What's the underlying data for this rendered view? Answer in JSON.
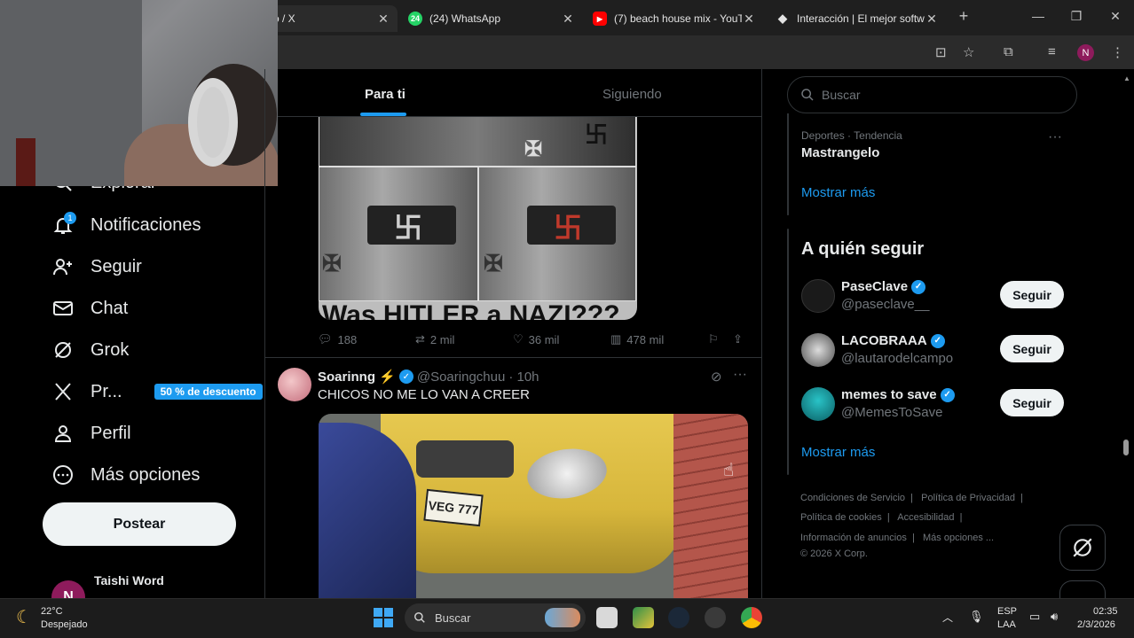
{
  "browser": {
    "tabs": [
      {
        "title": "o / X",
        "favicon": "x-logo-icon"
      },
      {
        "title": "(24) WhatsApp",
        "favicon": "whatsapp-icon",
        "badge": "24"
      },
      {
        "title": "(7) beach house mix - YouTu",
        "favicon": "youtube-icon"
      },
      {
        "title": "Interacción | El mejor softwa",
        "favicon": "diamond-icon"
      }
    ],
    "profile_initial": "N"
  },
  "nav": {
    "items": [
      {
        "label": "Explorar",
        "icon": "search-icon"
      },
      {
        "label": "Notificaciones",
        "icon": "bell-icon",
        "badge": "1"
      },
      {
        "label": "Seguir",
        "icon": "add-user-icon"
      },
      {
        "label": "Chat",
        "icon": "mail-icon"
      },
      {
        "label": "Grok",
        "icon": "grok-icon"
      },
      {
        "label": "Pr...",
        "icon": "x-logo-icon",
        "promo": "50 % de descuento"
      },
      {
        "label": "Perfil",
        "icon": "user-icon"
      },
      {
        "label": "Más opciones",
        "icon": "more-circle-icon"
      }
    ],
    "post_button": "Postear",
    "account_name": "Taishi Word",
    "account_initial": "N"
  },
  "feed": {
    "tabs": [
      "Para ti",
      "Siguiendo"
    ],
    "tweet1": {
      "image_caption": "Was HITLER a NAZI???",
      "replies": "188",
      "reposts": "2 mil",
      "likes": "36 mil",
      "views": "478 mil"
    },
    "tweet2": {
      "name": "Soarinng ⚡",
      "handle": "@Soaringchuu",
      "time": "· 10h",
      "text": "CHICOS NO ME LO VAN A CREER",
      "plate": "VEG 777"
    }
  },
  "sidebar": {
    "search_placeholder": "Buscar",
    "trend": {
      "meta": "Deportes · Tendencia",
      "name": "Mastrangelo"
    },
    "show_more": "Mostrar más",
    "who_to_follow_title": "A quién seguir",
    "follow_button": "Seguir",
    "suggestions": [
      {
        "name": "PaseClave",
        "handle": "@paseclave__"
      },
      {
        "name": "LACOBRAAA",
        "handle": "@lautarodelcampo"
      },
      {
        "name": "memes to save",
        "handle": "@MemesToSave"
      }
    ],
    "footer": {
      "line1a": "Condiciones de Servicio",
      "line1b": "Política de Privacidad",
      "line2a": "Política de cookies",
      "line2b": "Accesibilidad",
      "line3a": "Información de anuncios",
      "line3b": "Más opciones ...",
      "copyright": "© 2026 X Corp."
    }
  },
  "taskbar": {
    "weather_temp": "22°C",
    "weather_desc": "Despejado",
    "search": "Buscar",
    "lang1": "ESP",
    "lang2": "LAA",
    "time": "02:35",
    "date": "2/3/2026"
  },
  "colors": {
    "accent": "#1d9bf0",
    "background": "#000000",
    "muted": "#71767b"
  }
}
